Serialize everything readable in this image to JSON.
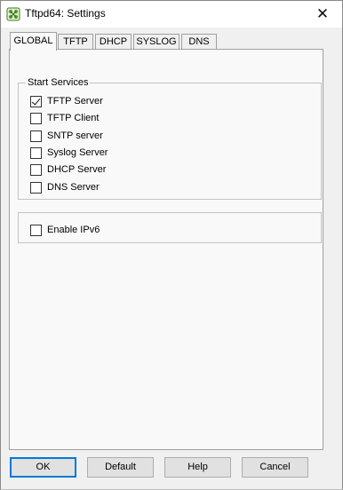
{
  "window": {
    "title": "Tftpd64: Settings",
    "close_symbol": "✕"
  },
  "tabs": [
    {
      "label": "GLOBAL",
      "active": true
    },
    {
      "label": "TFTP",
      "active": false
    },
    {
      "label": "DHCP",
      "active": false
    },
    {
      "label": "SYSLOG",
      "active": false
    },
    {
      "label": "DNS",
      "active": false
    }
  ],
  "start_services": {
    "title": "Start Services",
    "items": [
      {
        "label": "TFTP Server",
        "checked": true
      },
      {
        "label": "TFTP Client",
        "checked": false
      },
      {
        "label": "SNTP server",
        "checked": false
      },
      {
        "label": "Syslog Server",
        "checked": false
      },
      {
        "label": "DHCP Server",
        "checked": false
      },
      {
        "label": "DNS Server",
        "checked": false
      }
    ]
  },
  "ipv6": {
    "label": "Enable IPv6",
    "checked": false
  },
  "buttons": {
    "ok": "OK",
    "default": "Default",
    "help": "Help",
    "cancel": "Cancel"
  }
}
